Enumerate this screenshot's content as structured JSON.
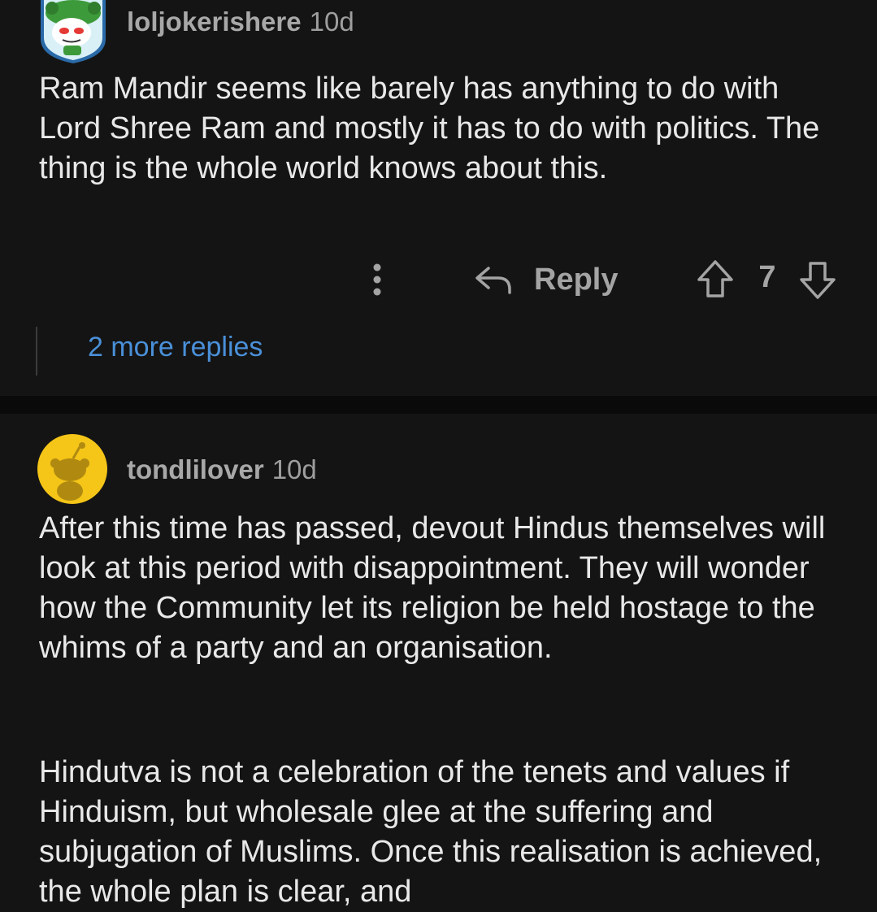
{
  "comments": [
    {
      "username": "loljokerishere",
      "age": "10d",
      "avatar_icon": "snoo-avatar-green-hat",
      "body": "Ram Mandir seems like barely has anything to do with Lord Shree Ram and mostly it has to do with politics. The thing is the whole world knows about this.",
      "actions": {
        "more_icon": "more-vertical-icon",
        "reply_label": "Reply",
        "score": "7"
      },
      "more_replies": "2 more replies"
    },
    {
      "username": "tondlilover",
      "age": "10d",
      "avatar_icon": "snoo-avatar-yellow",
      "paragraphs": [
        "After this time has passed, devout Hindus themselves will look at this period with disappointment. They will wonder how the Community let its religion be held hostage to the whims of a party and an organisation.",
        "Hindutva is not a celebration of the tenets and values if Hinduism, but wholesale glee at the suffering and subjugation of Muslims. Once this realisation is achieved, the whole plan is clear, and"
      ]
    }
  ],
  "colors": {
    "background": "#141414",
    "divider": "#0a0a0a",
    "body_text": "#e8e8e8",
    "meta_text": "#9e9e9e",
    "link": "#4a90d9",
    "avatar_yellow": "#f5c518",
    "avatar_green": "#3d9a3a"
  }
}
